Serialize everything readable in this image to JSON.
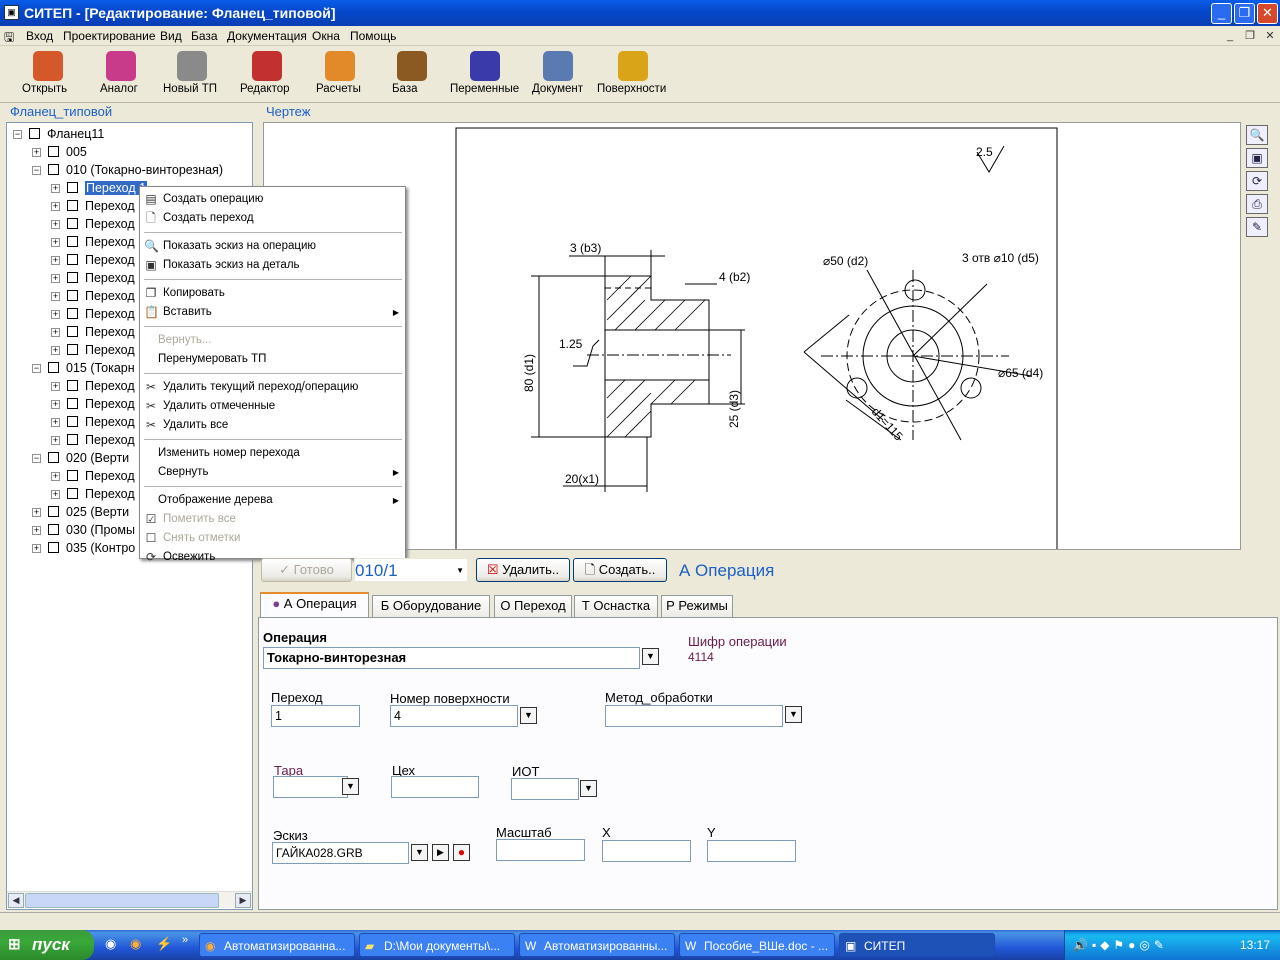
{
  "window": {
    "title": "СИТЕП - [Редактирование: Фланец_типовой]"
  },
  "menu": [
    "Вход",
    "Проектирование",
    "Вид",
    "База",
    "Документация",
    "Окна",
    "Помощь"
  ],
  "toolbar": [
    {
      "label": "Открыть",
      "icon": "open-folder-icon",
      "color": "#d4582a"
    },
    {
      "label": "Аналог",
      "icon": "analog-icon",
      "color": "#c83a8a"
    },
    {
      "label": "Новый ТП",
      "icon": "new-tp-icon",
      "color": "#8a8a8a"
    },
    {
      "label": "Редактор",
      "icon": "editor-icon",
      "color": "#c23030"
    },
    {
      "label": "Расчеты",
      "icon": "calculator-icon",
      "color": "#e28a2a"
    },
    {
      "label": "База",
      "icon": "database-icon",
      "color": "#8a5a22"
    },
    {
      "label": "Переменные",
      "icon": "variables-fx-icon",
      "color": "#3a3aaa"
    },
    {
      "label": "Документ",
      "icon": "document-icon",
      "color": "#5a7ab2"
    },
    {
      "label": "Поверхности",
      "icon": "surfaces-icon",
      "color": "#d9a418"
    }
  ],
  "tree": {
    "group_label": "Фланец_типовой",
    "nodes": [
      {
        "text": "Фланец11",
        "level": 0,
        "pm": "−"
      },
      {
        "text": "005",
        "level": 1,
        "pm": "+"
      },
      {
        "text": "010 (Токарно-винторезная)",
        "level": 1,
        "pm": "−"
      },
      {
        "text": "Переход 1",
        "level": 2,
        "pm": "+",
        "selected": true
      },
      {
        "text": "Переход",
        "level": 2,
        "pm": "+"
      },
      {
        "text": "Переход",
        "level": 2,
        "pm": "+"
      },
      {
        "text": "Переход",
        "level": 2,
        "pm": "+"
      },
      {
        "text": "Переход",
        "level": 2,
        "pm": "+"
      },
      {
        "text": "Переход",
        "level": 2,
        "pm": "+"
      },
      {
        "text": "Переход",
        "level": 2,
        "pm": "+"
      },
      {
        "text": "Переход",
        "level": 2,
        "pm": "+"
      },
      {
        "text": "Переход",
        "level": 2,
        "pm": "+"
      },
      {
        "text": "Переход",
        "level": 2,
        "pm": "+"
      },
      {
        "text": "015 (Токарн",
        "level": 1,
        "pm": "−"
      },
      {
        "text": "Переход",
        "level": 2,
        "pm": "+"
      },
      {
        "text": "Переход",
        "level": 2,
        "pm": "+"
      },
      {
        "text": "Переход",
        "level": 2,
        "pm": "+"
      },
      {
        "text": "Переход",
        "level": 2,
        "pm": "+"
      },
      {
        "text": "020 (Верти",
        "level": 1,
        "pm": "−"
      },
      {
        "text": "Переход",
        "level": 2,
        "pm": "+"
      },
      {
        "text": "Переход",
        "level": 2,
        "pm": "+"
      },
      {
        "text": "025 (Верти",
        "level": 1,
        "pm": "+"
      },
      {
        "text": "030 (Промы",
        "level": 1,
        "pm": "+"
      },
      {
        "text": "035 (Контро",
        "level": 1,
        "pm": "+"
      }
    ]
  },
  "context_menu": [
    {
      "label": "Создать операцию",
      "icon": "page-icon"
    },
    {
      "label": "Создать переход",
      "icon": "blank-page-icon"
    },
    {
      "sep": true
    },
    {
      "label": "Показать эскиз на операцию",
      "icon": "magnifier-icon"
    },
    {
      "label": "Показать эскиз на деталь",
      "icon": "preview-icon"
    },
    {
      "sep": true
    },
    {
      "label": "Копировать",
      "icon": "copy-icon"
    },
    {
      "label": "Вставить",
      "icon": "paste-icon",
      "submenu": true
    },
    {
      "sep": true
    },
    {
      "label": "Вернуть...",
      "disabled": true
    },
    {
      "label": "Перенумеровать ТП"
    },
    {
      "sep": true
    },
    {
      "label": "Удалить текущий переход/операцию",
      "icon": "scissors-icon"
    },
    {
      "label": "Удалить отмеченные",
      "icon": "scissors-icon"
    },
    {
      "label": "Удалить все",
      "icon": "scissors-icon"
    },
    {
      "sep": true
    },
    {
      "label": "Изменить номер перехода"
    },
    {
      "label": "Свернуть",
      "submenu": true
    },
    {
      "sep": true
    },
    {
      "label": "Отображение дерева",
      "submenu": true
    },
    {
      "label": "Пометить все",
      "icon": "checkbox-checked-icon",
      "disabled": true
    },
    {
      "label": "Снять отметки",
      "icon": "checkbox-empty-icon",
      "disabled": true
    },
    {
      "label": "Освежить",
      "icon": "refresh-icon"
    }
  ],
  "drawing": {
    "group_label": "Чертеж",
    "labels": [
      "2.5",
      "3 (b3)",
      "4 (b2)",
      "1.25",
      "80 (d1)",
      "25 (d3)",
      "20(x1)",
      "⌀50 (d2)",
      "3 отв ⌀10 (d5)",
      "⌀65 (d4)",
      "d1=115"
    ]
  },
  "action_bar": {
    "ready_label": "Готово",
    "code": "010/1",
    "delete_label": "Удалить..",
    "create_label": "Создать..",
    "section_title": "А Операция"
  },
  "tabs": [
    "А Операция",
    "Б Оборудование",
    "О Переход",
    "Т Оснастка",
    "Р Режимы"
  ],
  "form": {
    "operation_label": "Операция",
    "operation_value": "Токарно-винторезная",
    "cipher_label": "Шифр операции",
    "cipher_value": "4114",
    "transition_label": "Переход",
    "transition_value": "1",
    "surface_label": "Номер поверхности",
    "surface_value": "4",
    "method_label": "Метод_обработки",
    "method_value": "",
    "tara_label": "Тара",
    "tara_value": "",
    "ceh_label": "Цех",
    "ceh_value": "",
    "iot_label": "ИОТ",
    "iot_value": "",
    "sketch_label": "Эскиз",
    "sketch_value": "ГАЙКА028.GRB",
    "scale_label": "Масштаб",
    "scale_value": "",
    "x_label": "X",
    "x_value": "",
    "y_label": "Y",
    "y_value": ""
  },
  "taskbar": {
    "start_label": "пуск",
    "items": [
      "Автоматизированна...",
      "D:\\Мои документы\\...",
      "Автоматизированны...",
      "Пособие_ВШе.doc - ...",
      "СИТЕП"
    ],
    "clock": "13:17"
  }
}
